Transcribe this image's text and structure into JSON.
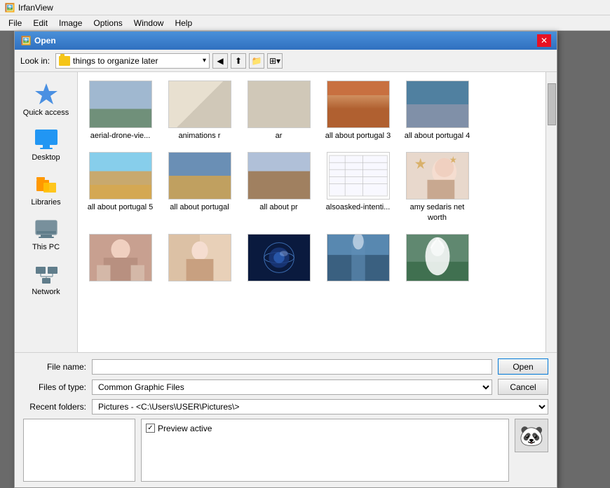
{
  "app": {
    "title": "IrfanView",
    "icon": "🖼️"
  },
  "menubar": {
    "items": [
      "File",
      "Edit",
      "Image",
      "Options",
      "Window",
      "Help"
    ]
  },
  "dialog": {
    "title": "Open",
    "look_in_label": "Look in:",
    "current_folder": "things to organize later",
    "toolbar_buttons": [
      "back",
      "up",
      "new-folder",
      "view-options"
    ],
    "file_name_label": "File name:",
    "file_name_value": "",
    "files_of_type_label": "Files of type:",
    "files_of_type_value": "Common Graphic Files",
    "recent_folders_label": "Recent folders:",
    "recent_folder_value": "Pictures  -  <C:\\Users\\USER\\Pictures\\>",
    "open_button": "Open",
    "cancel_button": "Cancel",
    "preview_active_label": "Preview active",
    "preview_checked": true
  },
  "sidebar": {
    "items": [
      {
        "id": "quick-access",
        "label": "Quick access",
        "icon": "star"
      },
      {
        "id": "desktop",
        "label": "Desktop",
        "icon": "desktop"
      },
      {
        "id": "libraries",
        "label": "Libraries",
        "icon": "libraries"
      },
      {
        "id": "this-pc",
        "label": "This PC",
        "icon": "thispc"
      },
      {
        "id": "network",
        "label": "Network",
        "icon": "network"
      }
    ]
  },
  "files": [
    {
      "name": "aerial-drone-vie...",
      "thumb_class": "thumb-drone"
    },
    {
      "name": "animations r",
      "thumb_class": "thumb-anim"
    },
    {
      "name": "ar",
      "thumb_class": "thumb-ar"
    },
    {
      "name": "all about portugal 3",
      "thumb_class": "thumb-port3"
    },
    {
      "name": "all about portugal 4",
      "thumb_class": "thumb-port4"
    },
    {
      "name": "all about portugal 5",
      "thumb_class": "thumb-beach"
    },
    {
      "name": "all about portugal",
      "thumb_class": "thumb-city"
    },
    {
      "name": "all about pr",
      "thumb_class": "thumb-street"
    },
    {
      "name": "alsoasked-intenti...",
      "thumb_class": "thumb-table"
    },
    {
      "name": "amy sedaris net worth",
      "thumb_class": "thumb-sedaris"
    },
    {
      "name": "",
      "thumb_class": "thumb-woman1"
    },
    {
      "name": "",
      "thumb_class": "thumb-woman2"
    },
    {
      "name": "",
      "thumb_class": "thumb-globe"
    },
    {
      "name": "",
      "thumb_class": "thumb-water"
    },
    {
      "name": "",
      "thumb_class": "thumb-angel"
    }
  ]
}
